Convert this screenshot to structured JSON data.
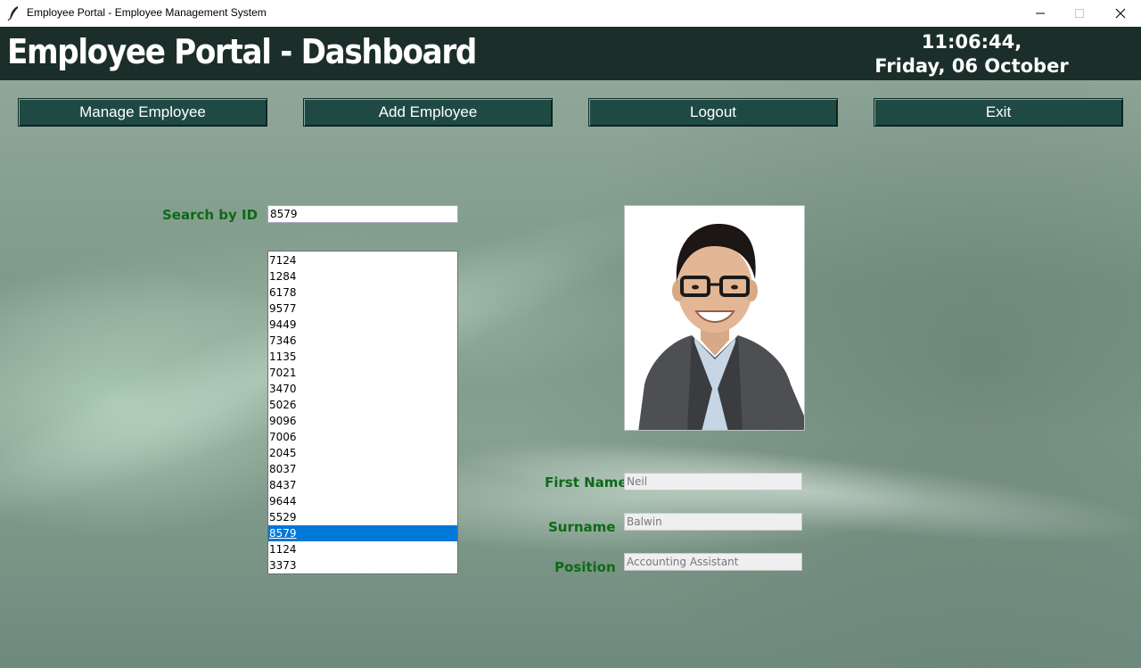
{
  "window": {
    "title": "Employee Portal - Employee Management System"
  },
  "header": {
    "title": "Employee Portal - Dashboard",
    "time": "11:06:44,",
    "date": "Friday, 06 October"
  },
  "nav": {
    "manage_label": "Manage Employee",
    "add_label": "Add Employee",
    "logout_label": "Logout",
    "exit_label": "Exit"
  },
  "search": {
    "label": "Search by ID",
    "value": "8579"
  },
  "employee_ids": [
    "7124",
    "1284",
    "6178",
    "9577",
    "9449",
    "7346",
    "1135",
    "7021",
    "3470",
    "5026",
    "9096",
    "7006",
    "2045",
    "8037",
    "8437",
    "9644",
    "5529",
    "8579",
    "1124",
    "3373"
  ],
  "selected_id": "8579",
  "details": {
    "first_name_label": "First Name",
    "first_name": "Neil",
    "surname_label": "Surname",
    "surname": "Balwin",
    "position_label": "Position",
    "position": "Accounting Assistant"
  },
  "colors": {
    "header_bg": "#1b2e2a",
    "button_bg": "#1f4a44",
    "label_green": "#0c6a16",
    "selection_blue": "#0078d7"
  },
  "icons": {
    "app": "feather-icon",
    "minimize": "minimize-icon",
    "maximize": "maximize-icon",
    "close": "close-icon"
  }
}
